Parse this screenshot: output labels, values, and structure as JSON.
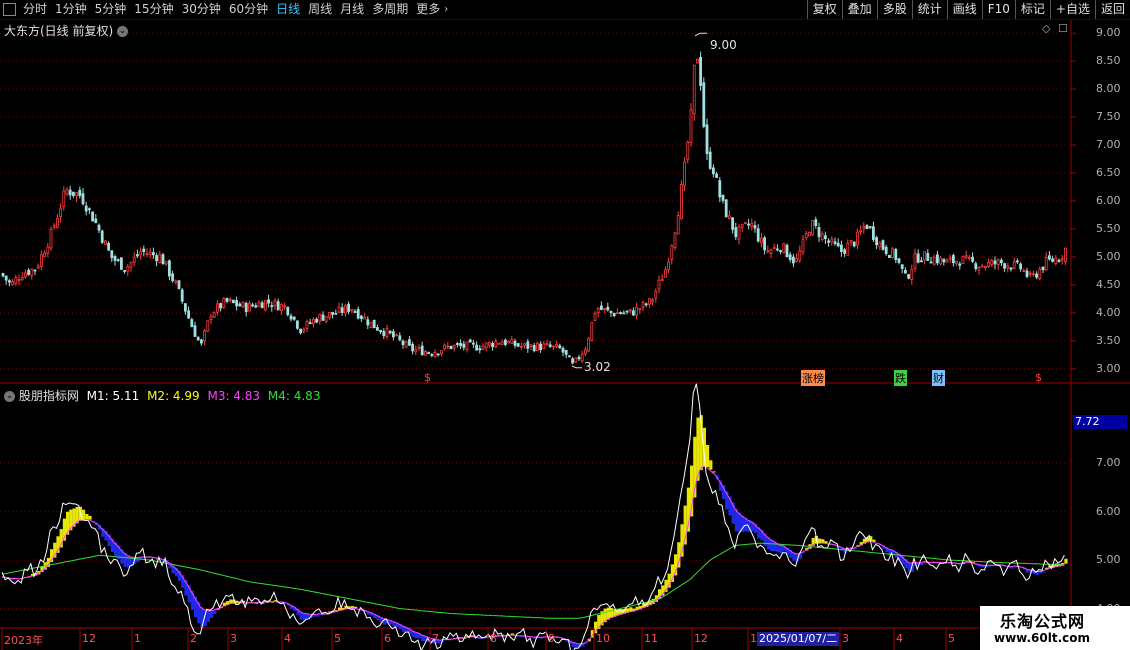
{
  "toolbar": {
    "left_items": [
      "分时",
      "1分钟",
      "5分钟",
      "15分钟",
      "30分钟",
      "60分钟",
      "日线",
      "周线",
      "月线",
      "多周期",
      "更多"
    ],
    "active": "日线",
    "right_items": [
      "复权",
      "叠加",
      "多股",
      "统计",
      "画线",
      "F10",
      "标记",
      "+自选",
      "返回"
    ]
  },
  "main": {
    "stock_title": "大东方(日线 前复权)",
    "y_ticks": [
      "9.00",
      "8.50",
      "8.00",
      "7.50",
      "7.00",
      "6.50",
      "6.00",
      "5.50",
      "5.00",
      "4.50",
      "4.00",
      "3.50",
      "3.00"
    ],
    "high_label": "9.00",
    "low_label": "3.02",
    "event_markers": [
      "$",
      "涨榜",
      "跌",
      "财",
      "$"
    ]
  },
  "indicator": {
    "name": "股朋指标网",
    "m1": "M1: 5.11",
    "m2": "M2: 4.99",
    "m3": "M3: 4.83",
    "m4": "M4: 4.83",
    "current_value": "7.72",
    "y_ticks": [
      "7.00",
      "6.00",
      "5.00",
      "4.00"
    ]
  },
  "timeline": {
    "labels": [
      "2023年",
      "12",
      "1",
      "2",
      "3",
      "4",
      "5",
      "6",
      "7",
      "8",
      "9",
      "10",
      "11",
      "12",
      "1",
      "3",
      "4",
      "5"
    ],
    "cursor_date": "2025/01/07/二"
  },
  "watermark": {
    "line1": "乐淘公式网",
    "line2": "www.60lt.com"
  },
  "colors": {
    "up": "#ff3c3c",
    "down": "#a0e0e0",
    "grid": "#7a0000",
    "m1": "#ffffff",
    "m2": "#ffff00",
    "m3": "#ff40ff",
    "m4": "#30e030",
    "accent": "#38c8ff"
  },
  "chart_data": {
    "type": "candlestick",
    "price_ylim": [
      2.8,
      9.2
    ],
    "indicator_ylim": [
      3.6,
      8.3
    ],
    "price_trend": [
      [
        0,
        4.7
      ],
      [
        10,
        4.5
      ],
      [
        20,
        4.7
      ],
      [
        35,
        4.8
      ],
      [
        50,
        5.4
      ],
      [
        65,
        6.2
      ],
      [
        80,
        6.1
      ],
      [
        95,
        5.6
      ],
      [
        110,
        5.0
      ],
      [
        125,
        4.8
      ],
      [
        140,
        5.1
      ],
      [
        160,
        5.0
      ],
      [
        175,
        4.5
      ],
      [
        190,
        3.8
      ],
      [
        200,
        3.4
      ],
      [
        210,
        4.0
      ],
      [
        225,
        4.2
      ],
      [
        245,
        4.1
      ],
      [
        265,
        4.2
      ],
      [
        285,
        4.1
      ],
      [
        300,
        3.7
      ],
      [
        315,
        3.9
      ],
      [
        335,
        4.0
      ],
      [
        350,
        4.1
      ],
      [
        370,
        3.8
      ],
      [
        390,
        3.6
      ],
      [
        410,
        3.35
      ],
      [
        430,
        3.3
      ],
      [
        450,
        3.4
      ],
      [
        480,
        3.4
      ],
      [
        500,
        3.5
      ],
      [
        520,
        3.4
      ],
      [
        545,
        3.4
      ],
      [
        560,
        3.35
      ],
      [
        572,
        3.05
      ],
      [
        585,
        3.4
      ],
      [
        595,
        4.1
      ],
      [
        610,
        4.0
      ],
      [
        630,
        4.0
      ],
      [
        650,
        4.2
      ],
      [
        665,
        4.8
      ],
      [
        675,
        5.6
      ],
      [
        683,
        6.5
      ],
      [
        690,
        7.5
      ],
      [
        695,
        8.8
      ],
      [
        700,
        8.1
      ],
      [
        705,
        6.8
      ],
      [
        712,
        6.6
      ],
      [
        720,
        6.0
      ],
      [
        735,
        5.4
      ],
      [
        750,
        5.6
      ],
      [
        765,
        5.1
      ],
      [
        780,
        5.2
      ],
      [
        795,
        4.9
      ],
      [
        810,
        5.6
      ],
      [
        825,
        5.3
      ],
      [
        840,
        5.1
      ],
      [
        855,
        5.3
      ],
      [
        865,
        5.6
      ],
      [
        880,
        5.2
      ],
      [
        895,
        5.0
      ],
      [
        905,
        4.6
      ],
      [
        915,
        5.0
      ],
      [
        930,
        5.0
      ],
      [
        945,
        4.9
      ],
      [
        960,
        4.95
      ],
      [
        980,
        4.85
      ],
      [
        1000,
        4.9
      ],
      [
        1020,
        4.8
      ],
      [
        1030,
        4.6
      ],
      [
        1045,
        4.9
      ],
      [
        1060,
        5.0
      ],
      [
        1066,
        5.2
      ]
    ],
    "indicator_m4": [
      [
        0,
        4.7
      ],
      [
        50,
        4.9
      ],
      [
        100,
        5.1
      ],
      [
        150,
        5.0
      ],
      [
        200,
        4.8
      ],
      [
        250,
        4.55
      ],
      [
        300,
        4.4
      ],
      [
        350,
        4.2
      ],
      [
        400,
        4.0
      ],
      [
        450,
        3.9
      ],
      [
        500,
        3.85
      ],
      [
        550,
        3.8
      ],
      [
        580,
        3.8
      ],
      [
        620,
        4.0
      ],
      [
        660,
        4.2
      ],
      [
        690,
        4.6
      ],
      [
        710,
        5.0
      ],
      [
        735,
        5.3
      ],
      [
        760,
        5.35
      ],
      [
        800,
        5.3
      ],
      [
        850,
        5.2
      ],
      [
        900,
        5.1
      ],
      [
        950,
        5.0
      ],
      [
        1000,
        4.95
      ],
      [
        1066,
        4.9
      ]
    ]
  }
}
